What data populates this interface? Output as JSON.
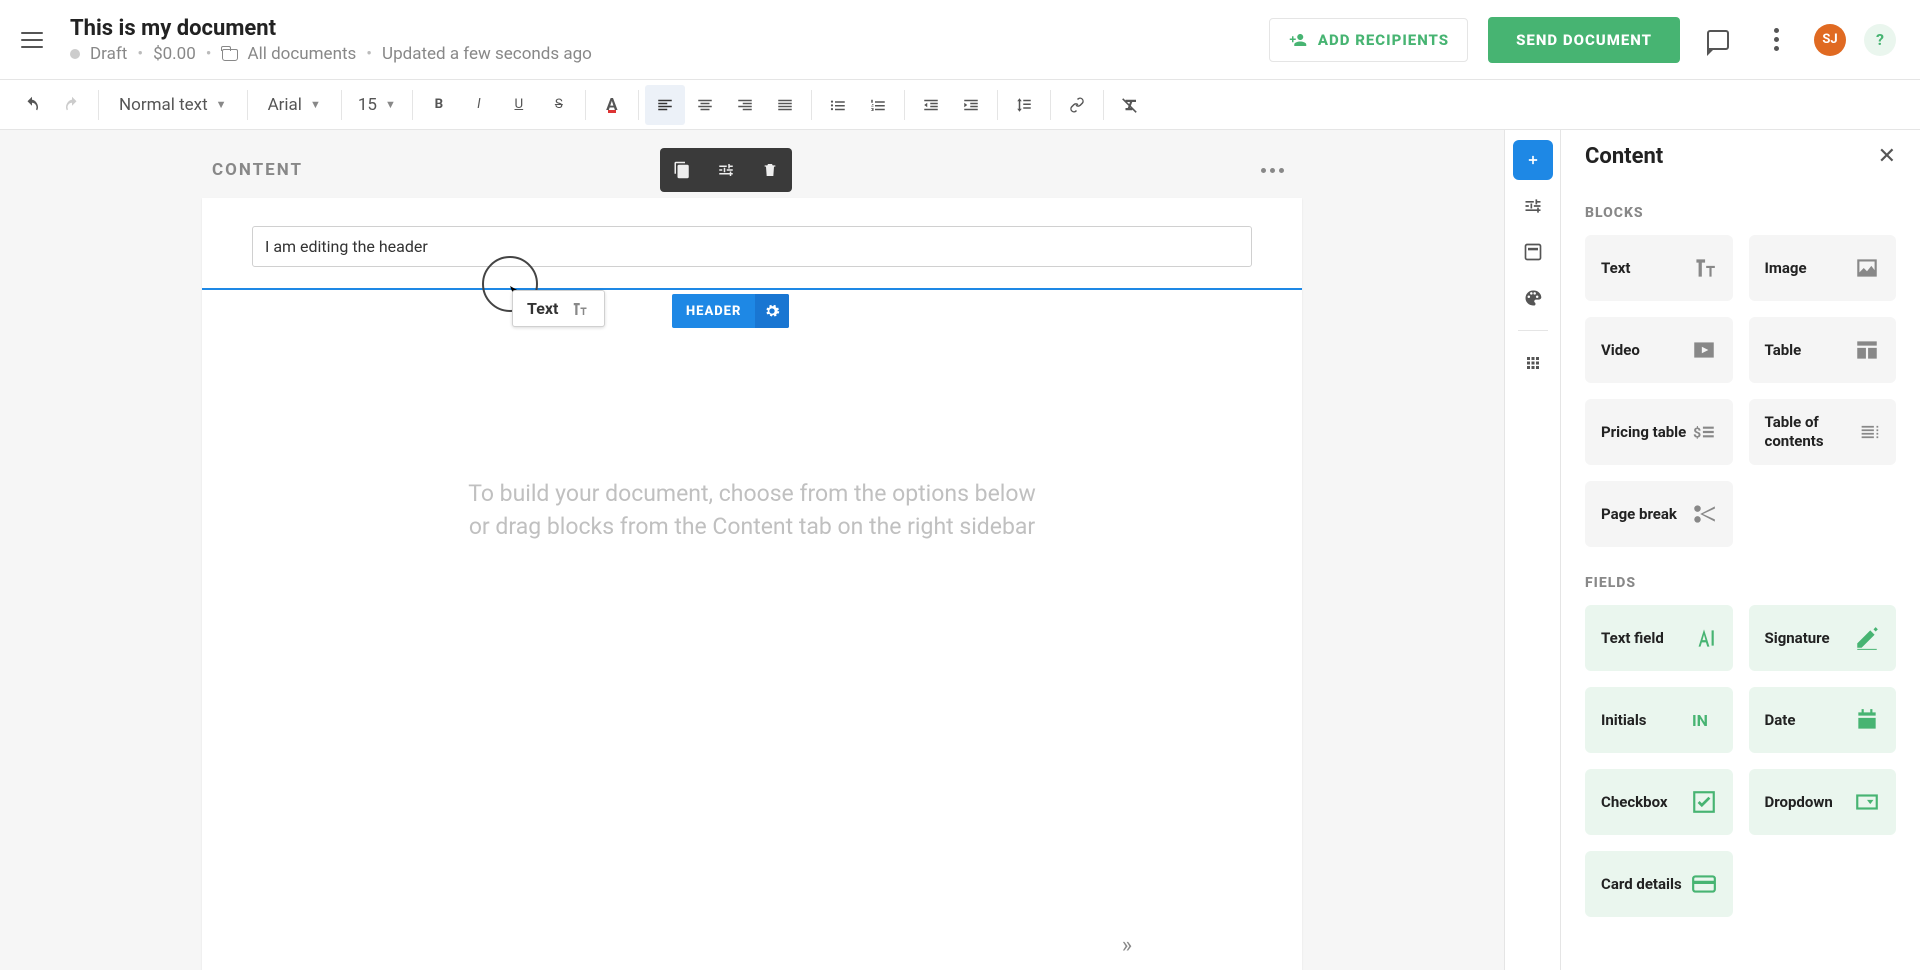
{
  "header": {
    "title": "This is my document",
    "status": "Draft",
    "amount": "$0.00",
    "location": "All documents",
    "updated": "Updated a few seconds ago",
    "add_recipients": "ADD RECIPIENTS",
    "send": "SEND DOCUMENT",
    "avatar": "SJ",
    "help": "?"
  },
  "toolbar": {
    "style": "Normal text",
    "font": "Arial",
    "size": "15"
  },
  "section": {
    "label": "CONTENT"
  },
  "doc": {
    "header_text": "I am editing the header",
    "drag_chip": "Text",
    "header_pill": "HEADER",
    "placeholder_l1": "To build your document, choose from the options below",
    "placeholder_l2": "or drag blocks from the Content tab on the right sidebar"
  },
  "right_panel": {
    "title": "Content",
    "blocks_label": "BLOCKS",
    "fields_label": "FIELDS",
    "blocks": {
      "text": "Text",
      "image": "Image",
      "video": "Video",
      "table": "Table",
      "pricing": "Pricing table",
      "toc": "Table of contents",
      "pagebreak": "Page break"
    },
    "fields": {
      "textfield": "Text field",
      "signature": "Signature",
      "initials": "Initials",
      "date": "Date",
      "checkbox": "Checkbox",
      "dropdown": "Dropdown",
      "card": "Card details"
    }
  }
}
